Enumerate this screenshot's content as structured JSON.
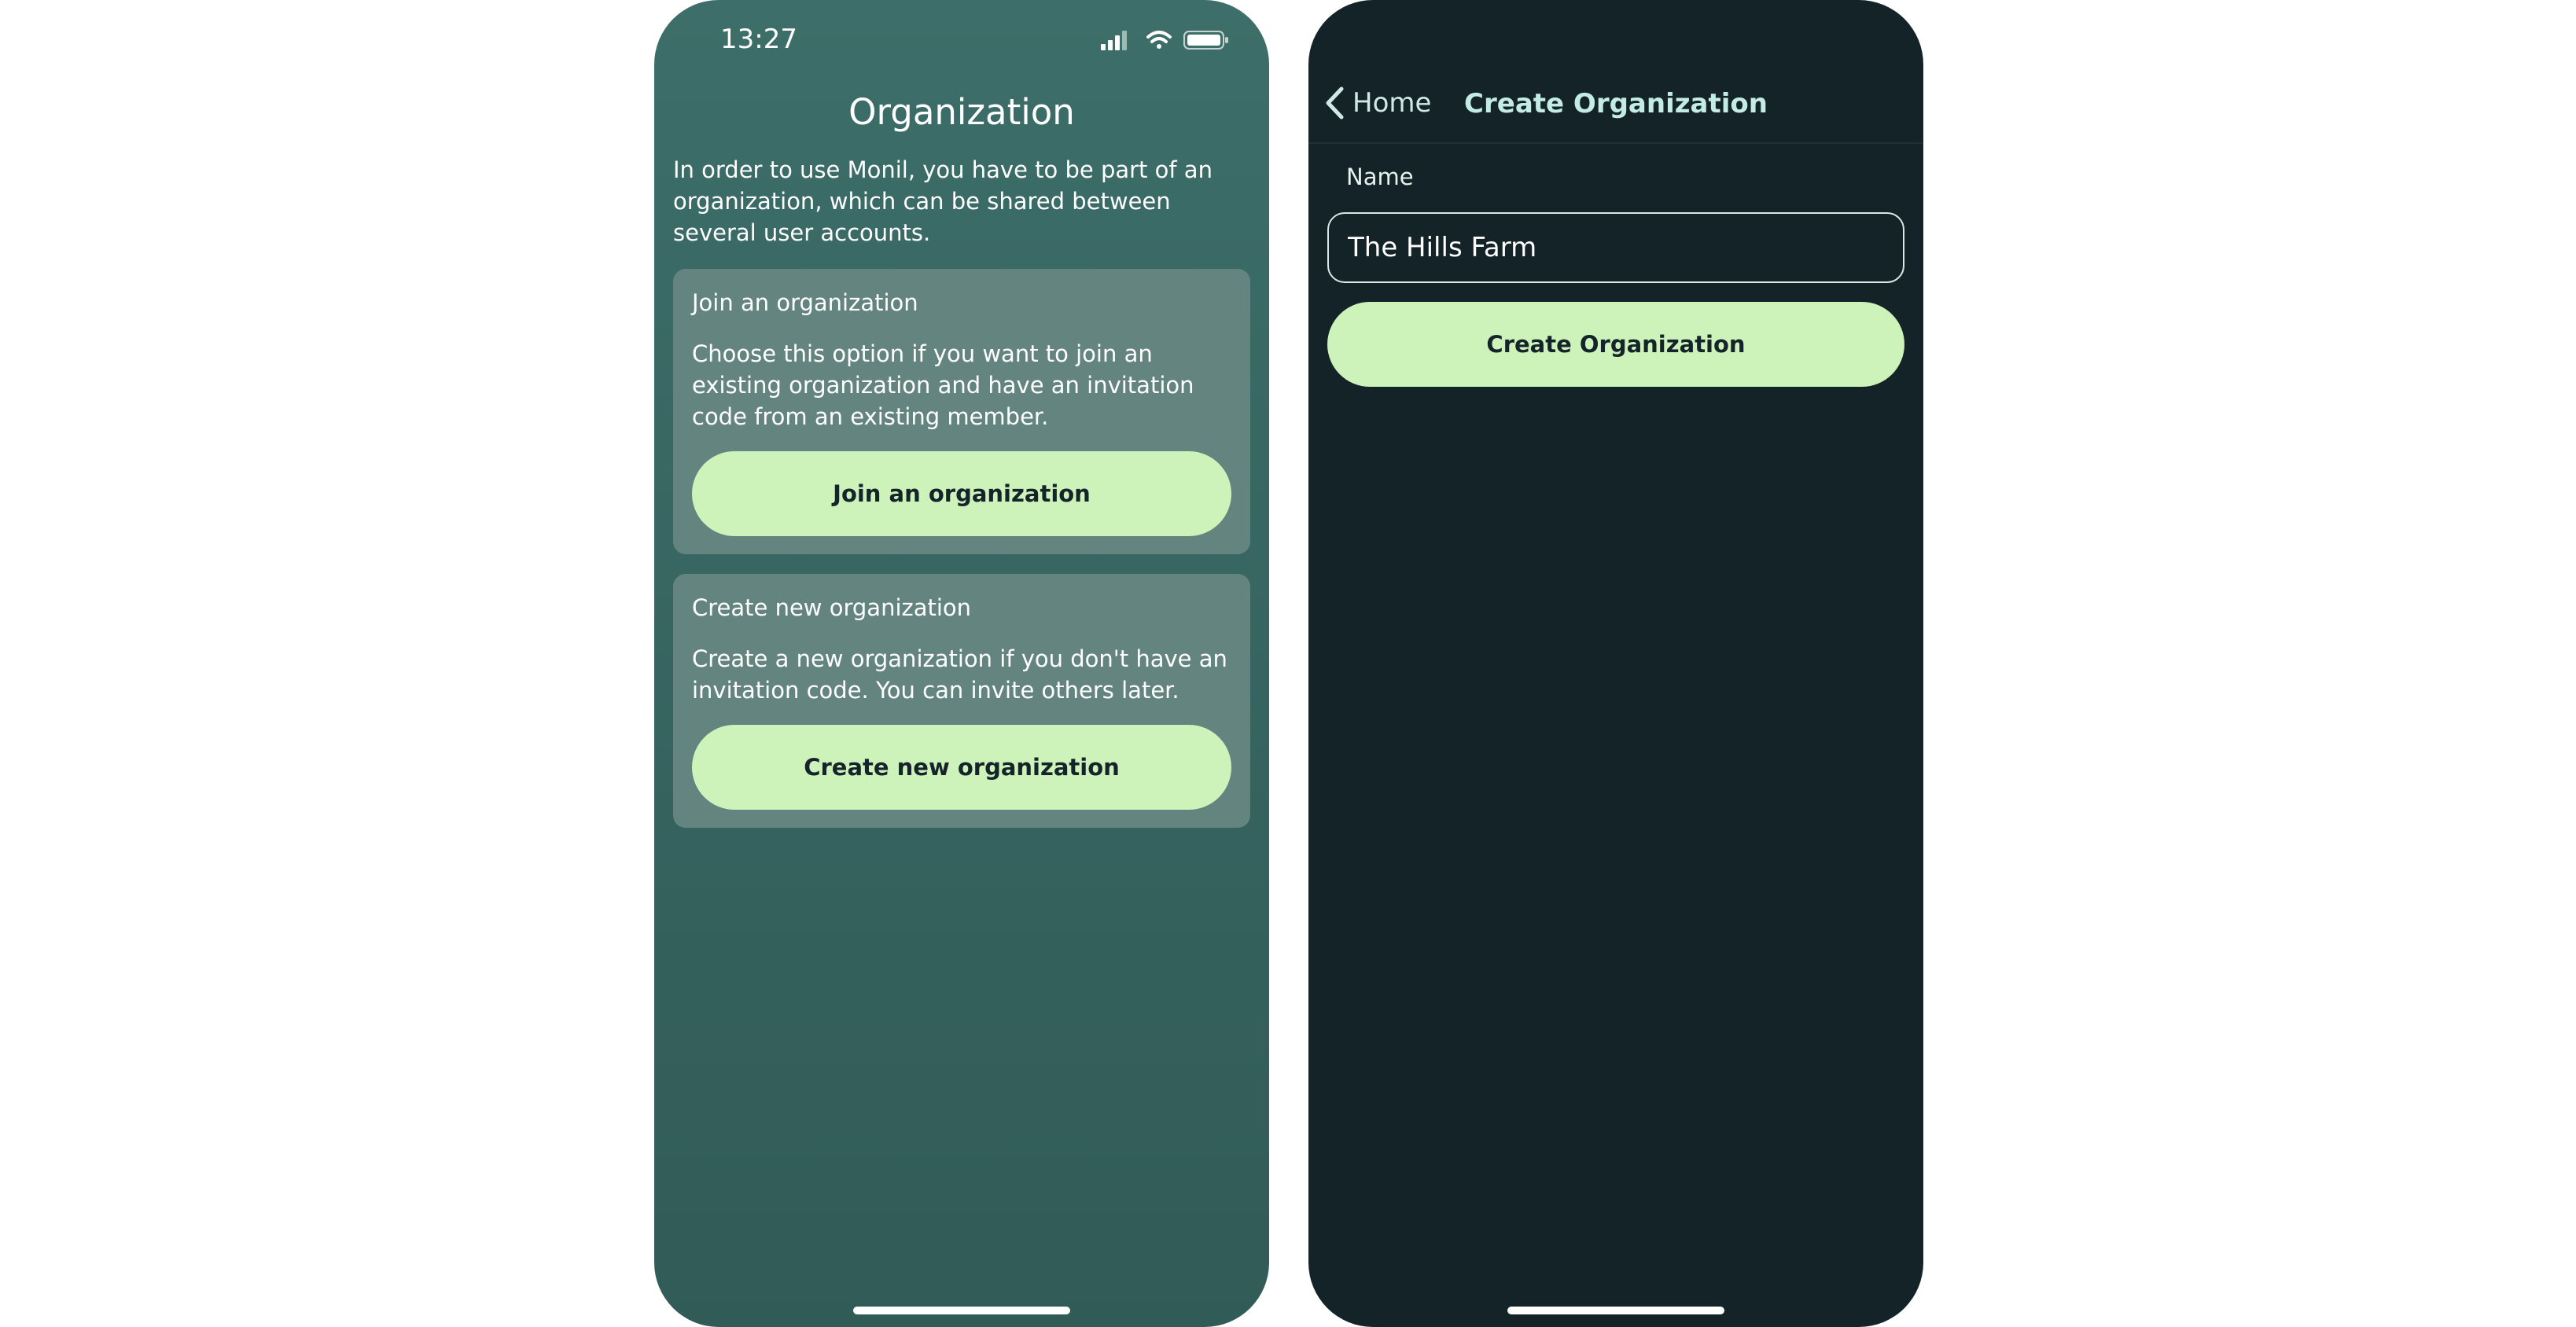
{
  "left_screen": {
    "status_bar": {
      "time": "13:27",
      "icons": [
        "signal-icon",
        "wifi-icon",
        "battery-icon"
      ]
    },
    "title": "Organization",
    "intro": "In order to use Monil, you have to be part of an organization, which can be shared between several user accounts.",
    "join_card": {
      "title": "Join an organization",
      "text": "Choose this option if you want to join an existing organization and have an invitation code from an existing member.",
      "button_label": "Join an organization"
    },
    "create_card": {
      "title": "Create new organization",
      "text": "Create a new organization if you don't have an invitation code. You can invite others later.",
      "button_label": "Create new organization"
    }
  },
  "right_screen": {
    "nav": {
      "back_icon": "chevron-left-icon",
      "back_label": "Home",
      "title": "Create Organization"
    },
    "name_field": {
      "label": "Name",
      "value": "The Hills Farm"
    },
    "submit_label": "Create Organization"
  },
  "colors": {
    "accent": "#cdf3bb",
    "left_background": "#3d6e69",
    "right_background": "#132327",
    "card": "#64857f"
  }
}
